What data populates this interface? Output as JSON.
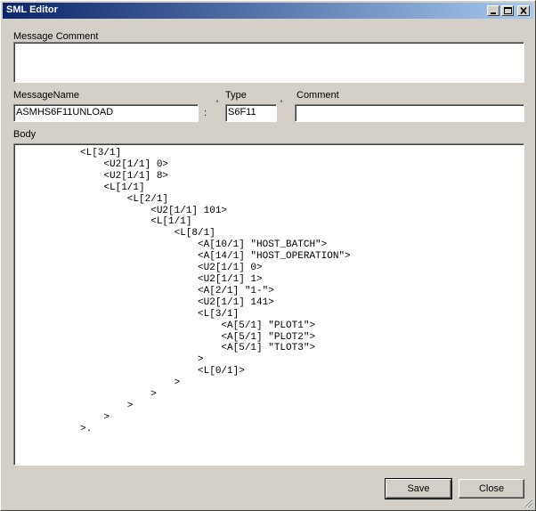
{
  "window": {
    "title": "SML Editor"
  },
  "fields": {
    "message_comment_label": "Message Comment",
    "message_comment_value": "",
    "message_name_label": "MessageName",
    "message_name_value": "ASMHS6F11UNLOAD",
    "type_label": "Type",
    "type_value": "S6F11",
    "comment_label": "Comment",
    "comment_value": "",
    "separator_colon": ":",
    "separator_quote1": "'",
    "separator_quote2": "'"
  },
  "body": {
    "label": "Body",
    "text": "<L[3/1]\n    <U2[1/1] 0>\n    <U2[1/1] 8>\n    <L[1/1]\n        <L[2/1]\n            <U2[1/1] 101>\n            <L[1/1]\n                <L[8/1]\n                    <A[10/1] \"HOST_BATCH\">\n                    <A[14/1] \"HOST_OPERATION\">\n                    <U2[1/1] 0>\n                    <U2[1/1] 1>\n                    <A[2/1] \"1-\">\n                    <U2[1/1] 141>\n                    <L[3/1]\n                        <A[5/1] \"PLOT1\">\n                        <A[5/1] \"PLOT2\">\n                        <A[5/1] \"TLOT3\">\n                    >\n                    <L[0/1]>\n                >\n            >\n        >\n    >\n>."
  },
  "buttons": {
    "save": "Save",
    "close": "Close"
  },
  "icons": {
    "minimize": "minimize-icon",
    "maximize": "maximize-icon",
    "close": "close-icon",
    "resize": "resize-grip-icon"
  },
  "colors": {
    "titlebar_start": "#0a246a",
    "titlebar_end": "#a6caf0",
    "face": "#d4d0c8"
  }
}
